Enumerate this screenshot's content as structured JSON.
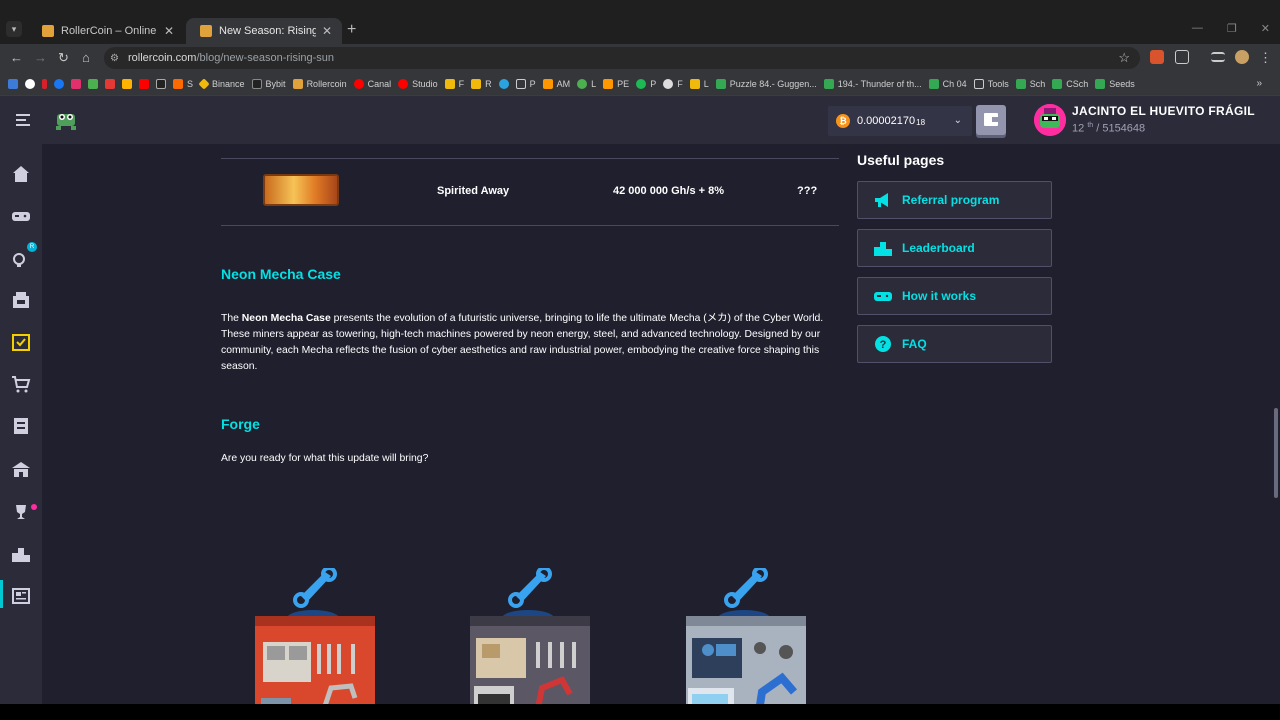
{
  "browser": {
    "tabs": [
      {
        "title": "RollerCoin – Online Bitcoin Mining Simulator",
        "active": false
      },
      {
        "title": "New Season: Rising Sun - RollerCoin",
        "active": true
      }
    ],
    "url_host": "rollercoin.com",
    "url_path": "/blog/new-season-rising-sun",
    "bookmarks": [
      "S",
      "Binance",
      "Bybit",
      "Rollercoin",
      "Canal",
      "Studio",
      "F",
      "R",
      "P",
      "AM",
      "L",
      "PE",
      "P",
      "F",
      "L",
      "Puzzle 84.- Guggen...",
      "194.- Thunder of th...",
      "Ch 04",
      "Tools",
      "Sch",
      "CSch",
      "Seeds"
    ]
  },
  "header": {
    "balance_main": "0.00002170",
    "balance_small": "18",
    "username": "JACINTO EL HUEVITO FRÁGIL",
    "rank_num": "12",
    "rank_suffix": "th",
    "rank_total": "/ 5154648"
  },
  "table_row": {
    "name": "Spirited Away",
    "power": "42 000 000 Gh/s + 8%",
    "price": "???"
  },
  "article": {
    "section1_title": "Neon Mecha Case",
    "section1_p_prefix": "The ",
    "section1_p_bold": "Neon Mecha Case",
    "section1_p_rest": " presents the evolution of a futuristic universe, bringing to life the ultimate Mecha (メカ) of the Cyber World. These miners appear as towering, high-tech machines powered by neon energy, steel, and advanced technology. Designed by our community, each Mecha reflects the fusion of cyber aesthetics and raw industrial power, embodying the creative force shaping this season.",
    "section2_title": "Forge",
    "section2_p": "Are you ready for what this update will bring?"
  },
  "useful": {
    "title": "Useful pages",
    "links": [
      {
        "label": "Referral program",
        "icon": "megaphone-icon"
      },
      {
        "label": "Leaderboard",
        "icon": "podium-icon"
      },
      {
        "label": "How it works",
        "icon": "gamepad-icon"
      },
      {
        "label": "FAQ",
        "icon": "question-icon"
      }
    ]
  },
  "colors": {
    "accent": "#03e1e4",
    "page_bg": "#1f1f2e",
    "panel_bg": "#2b2b3a"
  }
}
